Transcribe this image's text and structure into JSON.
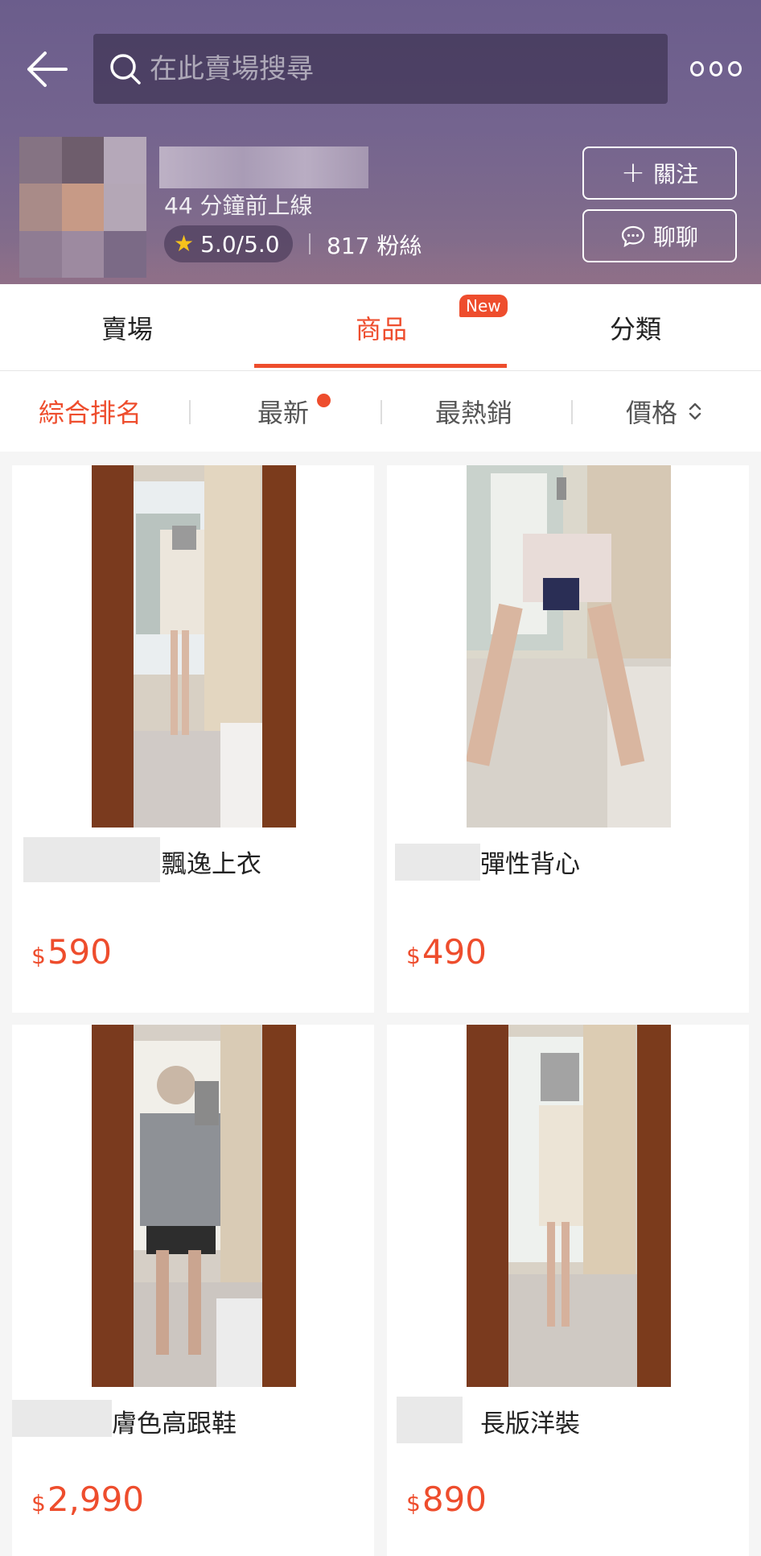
{
  "search": {
    "placeholder": "在此賣場搜尋"
  },
  "shop": {
    "online_status": "44 分鐘前上線",
    "rating": "5.0/5.0",
    "followers": "817 粉絲",
    "follow_label": "關注",
    "chat_label": "聊聊"
  },
  "tabs": [
    {
      "label": "賣場"
    },
    {
      "label": "商品",
      "badge": "New"
    },
    {
      "label": "分類"
    }
  ],
  "sort": [
    "綜合排名",
    "最新",
    "最熱銷",
    "價格"
  ],
  "products": [
    {
      "name": "飄逸上衣",
      "currency": "$",
      "price": "590"
    },
    {
      "name": "彈性背心",
      "currency": "$",
      "price": "490"
    },
    {
      "name": "膚色高跟鞋",
      "currency": "$",
      "price": "2,990"
    },
    {
      "name": "長版洋裝",
      "currency": "$",
      "price": "890"
    }
  ],
  "colors": {
    "accent": "#ee4d2d",
    "header": "#6b5d8c",
    "star": "#f6c21c"
  }
}
